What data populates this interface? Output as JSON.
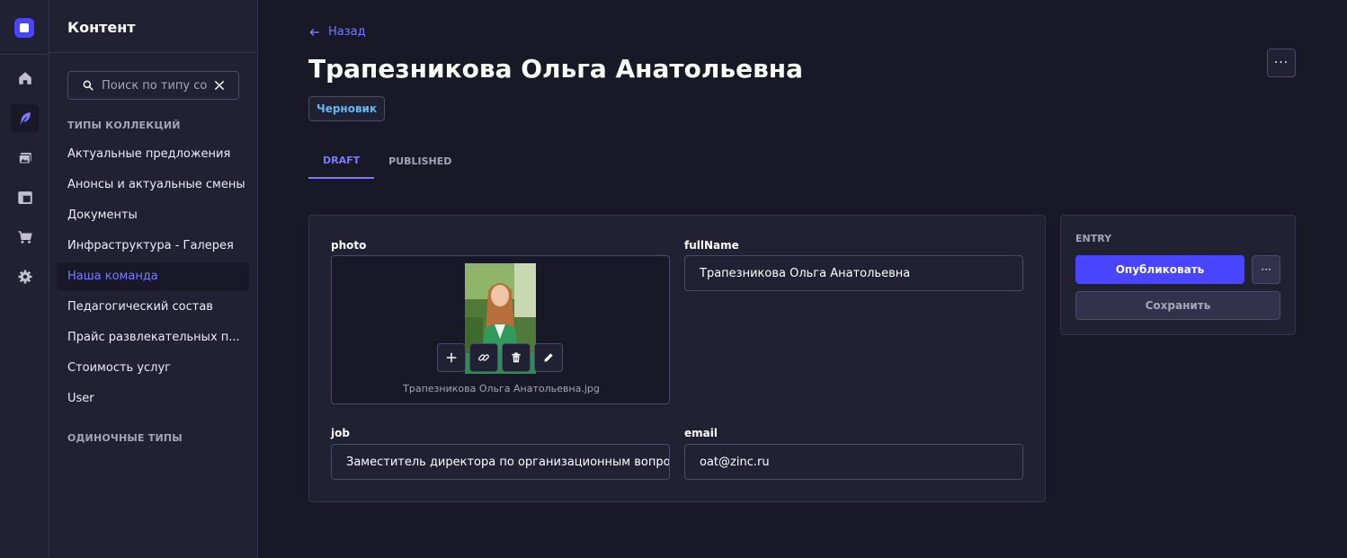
{
  "rail": {
    "items": [
      {
        "icon": "home-icon"
      },
      {
        "icon": "feather-icon",
        "active": true
      },
      {
        "icon": "media-library-icon"
      },
      {
        "icon": "layout-icon"
      },
      {
        "icon": "cart-icon"
      },
      {
        "icon": "gear-icon"
      }
    ]
  },
  "subnav": {
    "title": "Контент",
    "search_placeholder": "Поиск по типу содержимого",
    "collections_label": "ТИПЫ КОЛЛЕКЦИЙ",
    "items": [
      {
        "label": "Актуальные предложения"
      },
      {
        "label": "Анонсы и актуальные смены"
      },
      {
        "label": "Документы"
      },
      {
        "label": "Инфраструктура - Галерея"
      },
      {
        "label": "Наша команда",
        "active": true
      },
      {
        "label": "Педагогический состав"
      },
      {
        "label": "Прайс развлекательных п..."
      },
      {
        "label": "Стоимость услуг"
      },
      {
        "label": "User"
      }
    ],
    "single_types_label": "ОДИНОЧНЫЕ ТИПЫ"
  },
  "header": {
    "back_label": "Назад",
    "title": "Трапезникова Ольга Анатольевна",
    "more_label": "···",
    "status_badge": "Черновик"
  },
  "tabs": [
    {
      "label": "DRAFT",
      "active": true
    },
    {
      "label": "PUBLISHED"
    }
  ],
  "form": {
    "photo": {
      "label": "photo",
      "filename": "Трапезникова Ольга Анатольевна.jpg"
    },
    "fullName": {
      "label": "fullName",
      "value": "Трапезникова Ольга Анатольевна"
    },
    "job": {
      "label": "job",
      "value": "Заместитель директора по организационным вопросам"
    },
    "email": {
      "label": "email",
      "value": "oat@zinc.ru"
    }
  },
  "entry": {
    "label": "ENTRY",
    "publish_label": "Опубликовать",
    "more_label": "···",
    "save_label": "Сохранить"
  },
  "colors": {
    "background": "#181826",
    "panel": "#212134",
    "border": "#32324d",
    "accent": "#4945ff",
    "accent_text": "#7b79ff",
    "draft_badge": "#66b7f1"
  }
}
